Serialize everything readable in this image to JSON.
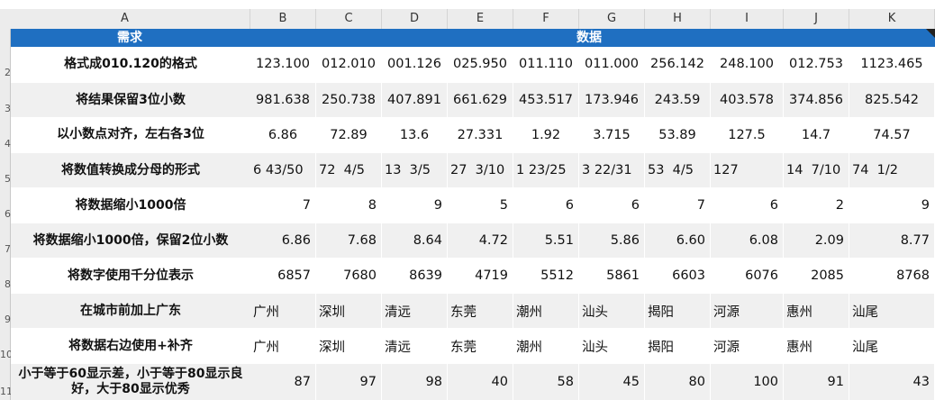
{
  "columns": [
    "A",
    "B",
    "C",
    "D",
    "E",
    "F",
    "G",
    "H",
    "I",
    "J",
    "K"
  ],
  "row_numbers": [
    "2",
    "3",
    "4",
    "5",
    "6",
    "7",
    "8",
    "9",
    "10",
    "11"
  ],
  "header": {
    "left": "需求",
    "right": "数据"
  },
  "rows": [
    {
      "label": "格式成010.120的格式",
      "align": "c",
      "values": [
        "123.100",
        "012.010",
        "001.126",
        "025.950",
        "011.110",
        "011.000",
        "256.142",
        "248.100",
        "012.753",
        "1123.465"
      ]
    },
    {
      "label": "将结果保留3位小数",
      "align": "c",
      "values": [
        "981.638",
        "250.738",
        "407.891",
        "661.629",
        "453.517",
        "173.946",
        "243.59",
        "403.578",
        "374.856",
        "825.542"
      ]
    },
    {
      "label": "以小数点对齐，左右各3位",
      "align": "c",
      "values": [
        "6.86",
        "72.89",
        "13.6",
        "27.331",
        "1.92",
        "3.715",
        "53.89",
        "127.5",
        "14.7",
        "74.57"
      ]
    },
    {
      "label": "将数值转换成分母的形式",
      "align": "pre",
      "values": [
        "6 43/50",
        "72  4/5",
        "13  3/5",
        "27  3/10",
        "1 23/25",
        "3 22/31",
        "53  4/5",
        "127",
        "14  7/10",
        "74  1/2"
      ]
    },
    {
      "label": "将数据缩小1000倍",
      "align": "r",
      "values": [
        "7",
        "8",
        "9",
        "5",
        "6",
        "6",
        "7",
        "6",
        "2",
        "9"
      ]
    },
    {
      "label": "将数据缩小1000倍，保留2位小数",
      "align": "r",
      "values": [
        "6.86",
        "7.68",
        "8.64",
        "4.72",
        "5.51",
        "5.86",
        "6.60",
        "6.08",
        "2.09",
        "8.77"
      ]
    },
    {
      "label": "将数字使用千分位表示",
      "align": "r",
      "values": [
        "6857",
        "7680",
        "8639",
        "4719",
        "5512",
        "5861",
        "6603",
        "6076",
        "2085",
        "8768"
      ]
    },
    {
      "label": "在城市前加上广东",
      "align": "l",
      "values": [
        "广州",
        "深圳",
        "清远",
        "东莞",
        "潮州",
        "汕头",
        "揭阳",
        "河源",
        "惠州",
        "汕尾"
      ]
    },
    {
      "label": "将数据右边使用+补齐",
      "align": "l",
      "values": [
        "广州",
        "深圳",
        "清远",
        "东莞",
        "潮州",
        "汕头",
        "揭阳",
        "河源",
        "惠州",
        "汕尾"
      ]
    },
    {
      "label": "小于等于60显示差，小于等于80显示良好，大于80显示优秀",
      "align": "r",
      "values": [
        "87",
        "97",
        "98",
        "40",
        "58",
        "45",
        "80",
        "100",
        "91",
        "43"
      ]
    }
  ]
}
